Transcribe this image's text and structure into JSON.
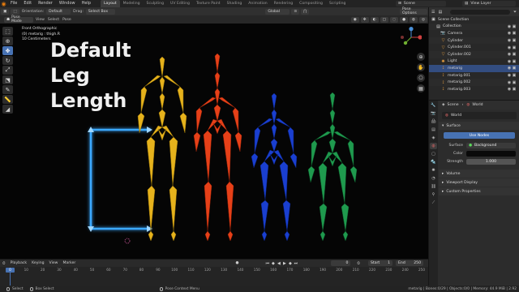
{
  "menu": [
    "File",
    "Edit",
    "Render",
    "Window",
    "Help"
  ],
  "workspace_tabs": [
    "Layout",
    "Modeling",
    "Sculpting",
    "UV Editing",
    "Texture Paint",
    "Shading",
    "Animation",
    "Rendering",
    "Compositing",
    "Scripting"
  ],
  "scene_name": "Scene",
  "view_layer": "View Layer",
  "header": {
    "orientation_label": "Orientation:",
    "orientation_value": "Default",
    "drag_label": "Drag:",
    "drag_value": "Select Box",
    "transform": "Global",
    "pose_options": "Pose Options"
  },
  "header2": {
    "mode": "Pose Mode",
    "view": "View",
    "select": "Select",
    "pose": "Pose"
  },
  "viewport_info": {
    "line1": "Front Orthographic",
    "line2": "(0) metarig : thigh.R",
    "line3": "10 Centimeters"
  },
  "overlay_title": [
    "Default",
    "Leg",
    "Length"
  ],
  "outliner": {
    "root": "Scene Collection",
    "items": [
      {
        "name": "Collection",
        "icon": "collection-icon"
      },
      {
        "name": "Camera",
        "icon": "camera-icon"
      },
      {
        "name": "Cylinder",
        "icon": "mesh-icon"
      },
      {
        "name": "Cylinder.001",
        "icon": "mesh-icon"
      },
      {
        "name": "Cylinder.002",
        "icon": "mesh-icon"
      },
      {
        "name": "Light",
        "icon": "light-icon"
      },
      {
        "name": "metarig",
        "icon": "armature-icon"
      },
      {
        "name": "metarig.001",
        "icon": "armature-icon"
      },
      {
        "name": "metarig.002",
        "icon": "armature-icon"
      },
      {
        "name": "metarig.003",
        "icon": "armature-icon"
      }
    ]
  },
  "properties": {
    "scene": "Scene",
    "world_tab": "World",
    "world_name": "World",
    "surface_section": "Surface",
    "use_nodes": "Use Nodes",
    "surface_label": "Surface",
    "surface_value": "Background",
    "color_label": "Color",
    "strength_label": "Strength",
    "strength_value": "1.000",
    "volume_section": "Volume",
    "viewport_display_section": "Viewport Display",
    "custom_props_section": "Custom Properties"
  },
  "timeline": {
    "playback": "Playback",
    "keying": "Keying",
    "view": "View",
    "marker": "Marker",
    "current_frame": "0",
    "start_label": "Start",
    "start_value": "1",
    "end_label": "End",
    "end_value": "250",
    "ruler_ticks": [
      "0",
      "10",
      "20",
      "30",
      "40",
      "50",
      "60",
      "70",
      "80",
      "90",
      "100",
      "110",
      "120",
      "130",
      "140",
      "150",
      "160",
      "170",
      "180",
      "190",
      "200",
      "210",
      "220",
      "230",
      "240",
      "250"
    ],
    "cursor_frame": "0"
  },
  "status": {
    "select": "Select",
    "box_select": "Box Select",
    "context_menu": "Pose Context Menu",
    "stats": "metarig | Bones:0/29 | Objects:0/0 | Memory: 44.9 MiB | 2.92"
  },
  "colors": {
    "accent": "#4772b3",
    "rig_yellow": "#e6b21c",
    "rig_red": "#e64018",
    "rig_blue": "#1a3fd0",
    "rig_green": "#1f9a4e",
    "measure_glow": "#3aa8ff"
  }
}
